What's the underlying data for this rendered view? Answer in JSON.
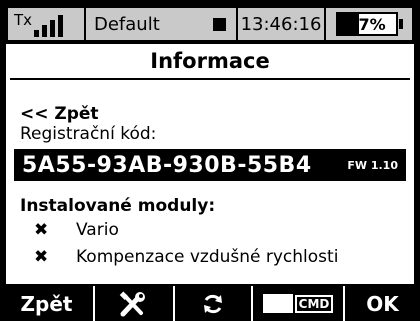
{
  "status_bar": {
    "tx_label": "Tx",
    "signal_bars": 4,
    "model_name": "Default",
    "time": "13:46:16",
    "battery_percent_text": "37%",
    "battery_level": 0.37
  },
  "screen": {
    "title": "Informace",
    "back_link": "<< Zpět",
    "registration_label": "Registrační kód:",
    "registration_code": "5A55-93AB-930B-55B4",
    "firmware": "FW 1.10",
    "modules_label": "Instalované moduly:",
    "modules": [
      {
        "mark": "✖",
        "name": "Vario"
      },
      {
        "mark": "✖",
        "name": "Kompenzace vzdušné rychlosti"
      }
    ]
  },
  "bottom_bar": {
    "back_label": "Zpět",
    "tools_icon": "wrench-screwdriver-icon",
    "refresh_icon": "refresh-icon",
    "cmd_label": "CMD",
    "ok_label": "OK"
  }
}
